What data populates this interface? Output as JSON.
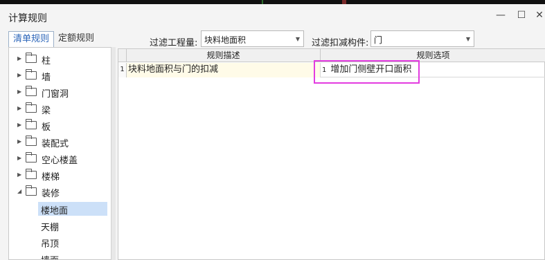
{
  "window": {
    "title": "计算规则"
  },
  "tabs": [
    {
      "label": "清单规则"
    },
    {
      "label": "定额规则"
    }
  ],
  "filters": {
    "project_label": "过滤工程量:",
    "project_value": "块料地面积",
    "component_label": "过滤扣减构件:",
    "component_value": "门"
  },
  "tree": {
    "folders": [
      {
        "label": "柱"
      },
      {
        "label": "墙"
      },
      {
        "label": "门窗洞"
      },
      {
        "label": "梁"
      },
      {
        "label": "板"
      },
      {
        "label": "装配式"
      },
      {
        "label": "空心楼盖"
      },
      {
        "label": "楼梯"
      },
      {
        "label": "装修"
      }
    ],
    "leaves": [
      {
        "label": "楼地面"
      },
      {
        "label": "天棚"
      },
      {
        "label": "吊顶"
      },
      {
        "label": "墙面"
      }
    ]
  },
  "grid": {
    "headers": [
      "规则描述",
      "规则选项"
    ],
    "rows": [
      {
        "num": "1",
        "desc": "块料地面积与门的扣减",
        "option_index": "1",
        "option": "增加门侧壁开口面积"
      }
    ]
  },
  "colors": {
    "accent": "#2a64b8",
    "selected": "#cce0f8",
    "highlight_box": "#e33be0"
  }
}
